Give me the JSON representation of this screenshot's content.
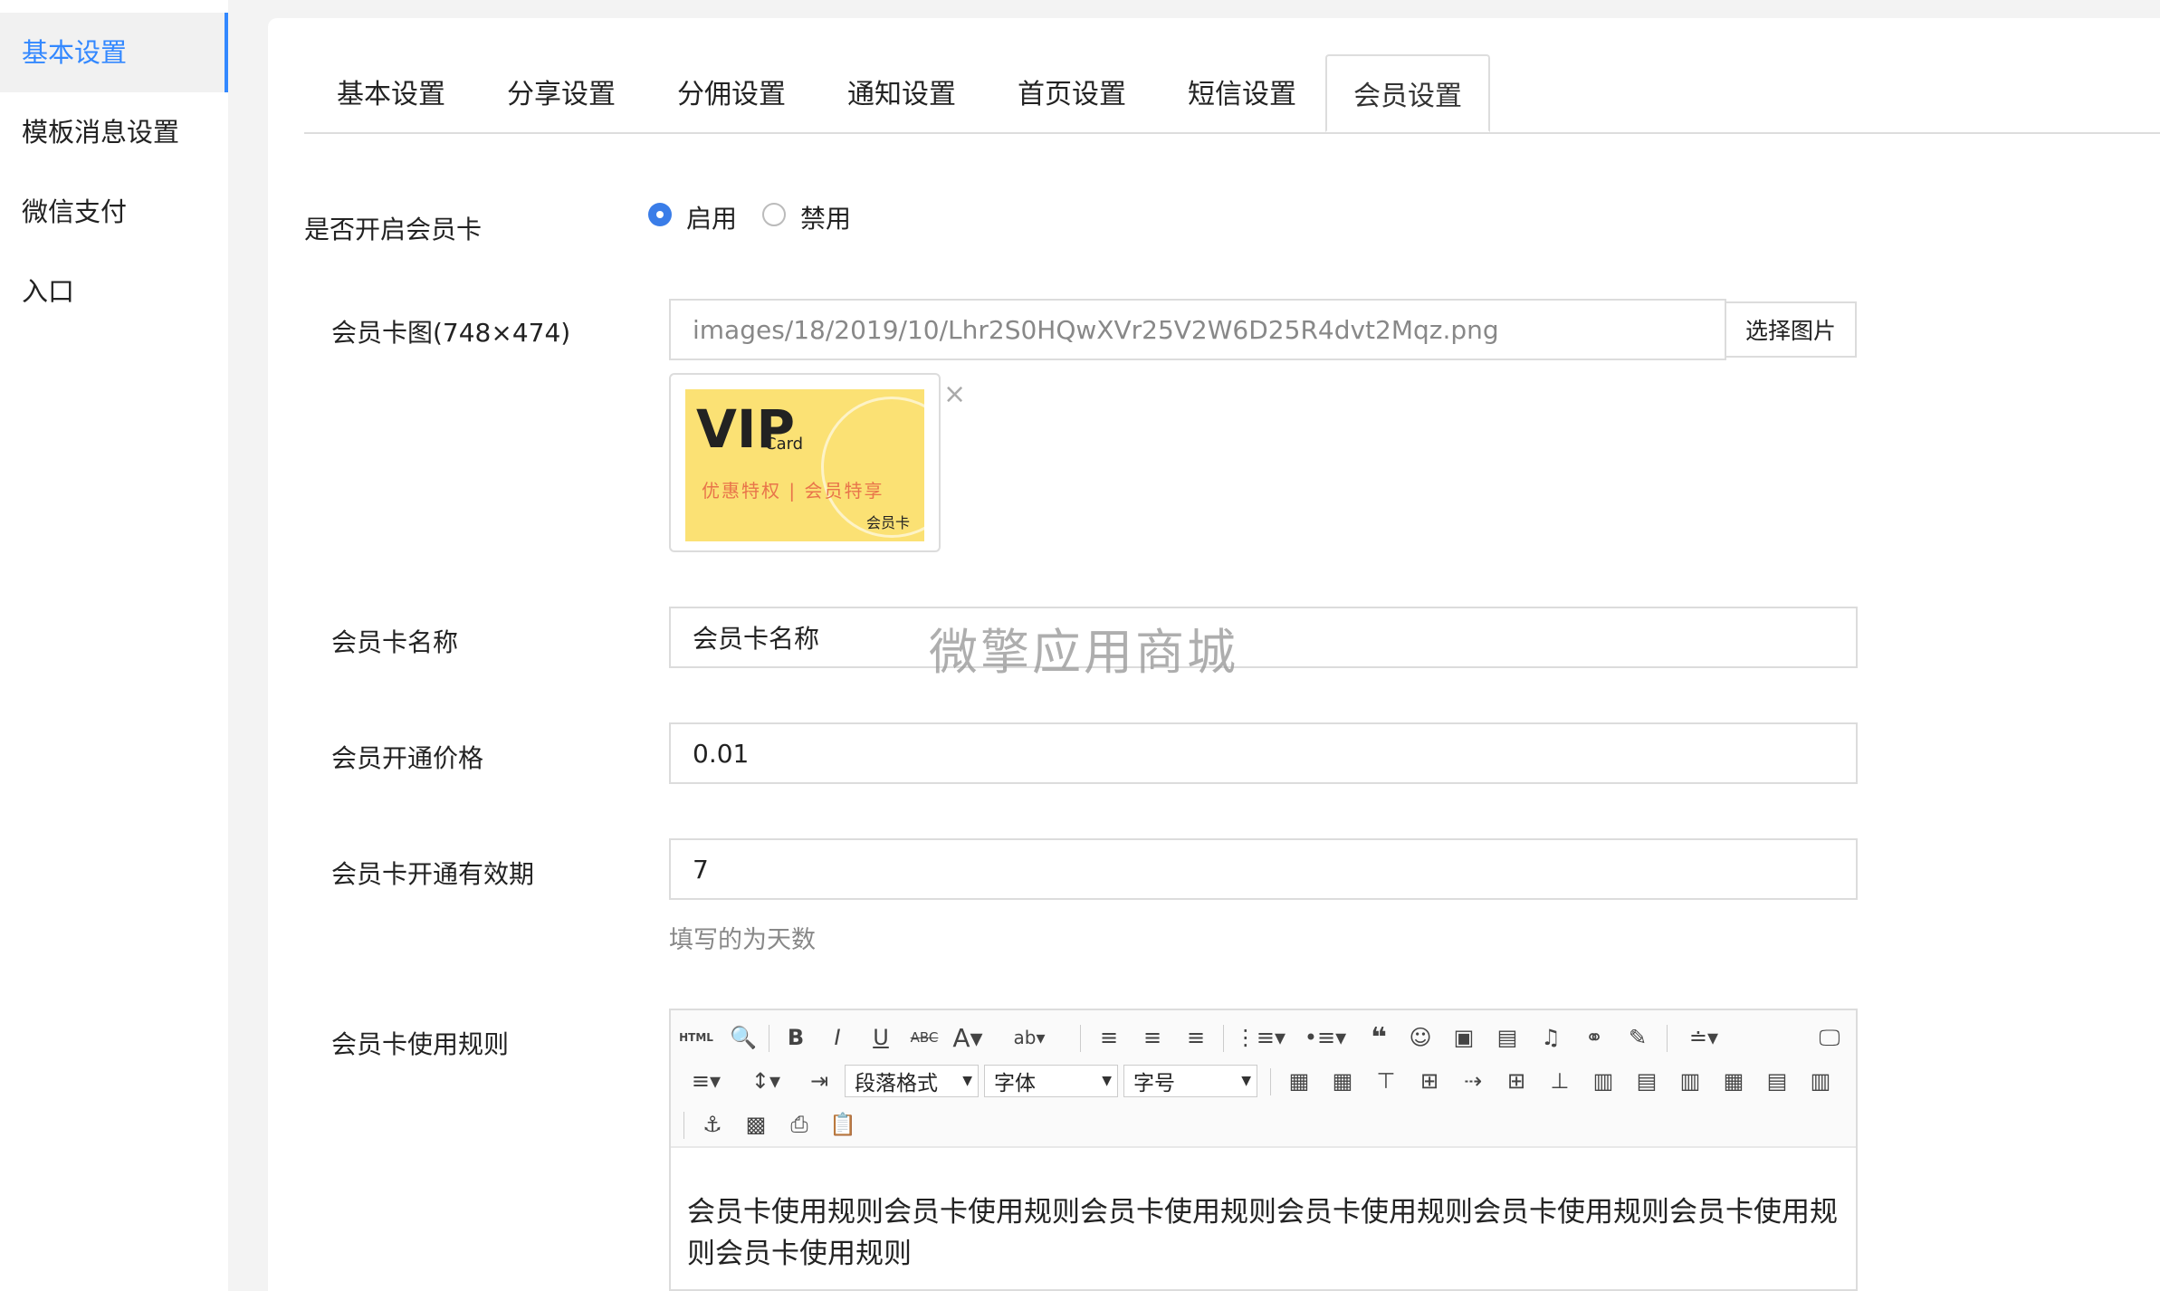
{
  "sidebar": {
    "items": [
      {
        "label": "基本设置",
        "active": true
      },
      {
        "label": "模板消息设置",
        "active": false
      },
      {
        "label": "微信支付",
        "active": false
      },
      {
        "label": "入口",
        "active": false
      }
    ]
  },
  "tabs": [
    {
      "label": "基本设置"
    },
    {
      "label": "分享设置"
    },
    {
      "label": "分佣设置"
    },
    {
      "label": "通知设置"
    },
    {
      "label": "首页设置"
    },
    {
      "label": "短信设置"
    },
    {
      "label": "会员设置",
      "active": true
    }
  ],
  "form": {
    "enable_card": {
      "label": "是否开启会员卡",
      "options": [
        {
          "label": "启用",
          "selected": true
        },
        {
          "label": "禁用",
          "selected": false
        }
      ]
    },
    "card_image": {
      "label": "会员卡图(748×474)",
      "value": "images/18/2019/10/Lhr2S0HQwXVr25V2W6D25R4dvt2Mqz.png",
      "button": "选择图片",
      "remove": "×",
      "preview": {
        "title": "VIP",
        "card": "Card",
        "subtitle": "优惠特权 | 会员特享",
        "small": "会员卡"
      }
    },
    "card_name": {
      "label": "会员卡名称",
      "value": "会员卡名称"
    },
    "price": {
      "label": "会员开通价格",
      "value": "0.01"
    },
    "validity": {
      "label": "会员卡开通有效期",
      "value": "7",
      "hint": "填写的为天数"
    },
    "rules": {
      "label": "会员卡使用规则",
      "toolbar": {
        "paragraph": "段落格式",
        "font": "字体",
        "size": "字号"
      },
      "content": "会员卡使用规则会员卡使用规则会员卡使用规则会员卡使用规则会员卡使用规则会员卡使用规则会员卡使用规则"
    }
  },
  "watermark": "微擎应用商城",
  "colors": {
    "accent": "#3388ff",
    "radio": "#3a7de8",
    "card": "#fbe174"
  }
}
